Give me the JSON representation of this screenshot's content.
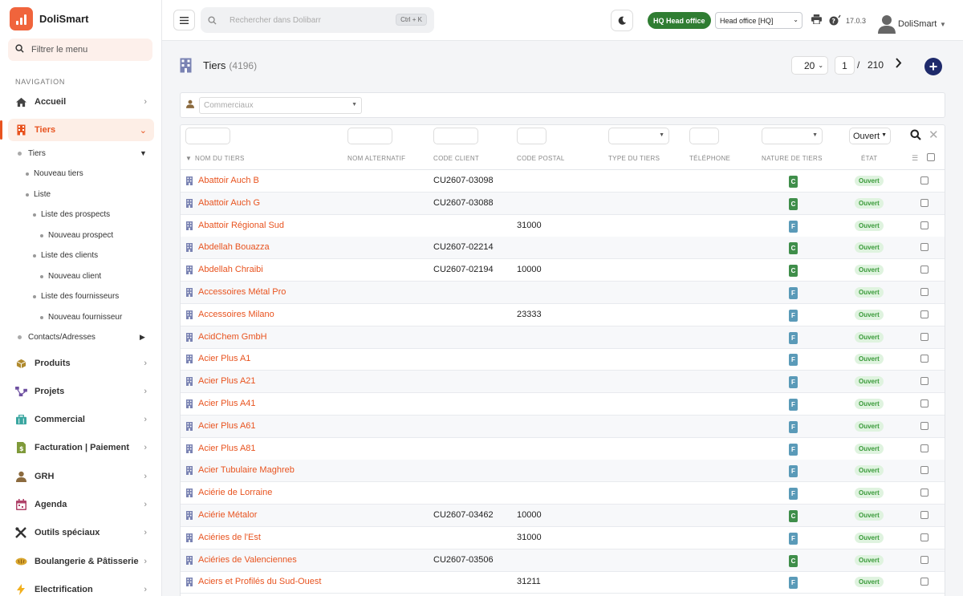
{
  "brand": {
    "name": "DoliSmart"
  },
  "sidebar": {
    "filter_placeholder": "Filtrer le menu",
    "nav_title": "NAVIGATION",
    "items": [
      {
        "label": "Accueil",
        "icon": "home-icon"
      },
      {
        "label": "Tiers",
        "icon": "building-icon"
      },
      {
        "label": "Produits",
        "icon": "box-icon"
      },
      {
        "label": "Projets",
        "icon": "projects-icon"
      },
      {
        "label": "Commercial",
        "icon": "briefcase-icon"
      },
      {
        "label": "Facturation | Paiement",
        "icon": "invoice-icon"
      },
      {
        "label": "GRH",
        "icon": "user-icon"
      },
      {
        "label": "Agenda",
        "icon": "calendar-icon"
      },
      {
        "label": "Outils spéciaux",
        "icon": "tools-icon"
      },
      {
        "label": "Boulangerie & Pâtisserie",
        "icon": "bread-icon"
      },
      {
        "label": "Electrification",
        "icon": "bolt-icon"
      }
    ],
    "sub": {
      "tiers": "Tiers",
      "nouveau_tiers": "Nouveau tiers",
      "liste": "Liste",
      "liste_prospects": "Liste des prospects",
      "nouveau_prospect": "Nouveau prospect",
      "liste_clients": "Liste des clients",
      "nouveau_client": "Nouveau client",
      "liste_fournisseurs": "Liste des fournisseurs",
      "nouveau_fournisseur": "Nouveau fournisseur",
      "contacts": "Contacts/Adresses"
    }
  },
  "topbar": {
    "search_placeholder": "Rechercher dans Dolibarr",
    "search_shortcut": "Ctrl + K",
    "hq_badge": "HQ Head office",
    "entity": "Head office [HQ]",
    "version": "17.0.3",
    "user": "DoliSmart"
  },
  "page": {
    "title": "Tiers",
    "count": "(4196)",
    "limit": "20",
    "page": "1",
    "page_sep": "/",
    "total_pages": "210"
  },
  "filters": {
    "commerciaux_placeholder": "Commerciaux",
    "etat": "Ouvert"
  },
  "columns": {
    "nom": "NOM DU TIERS",
    "alt": "NOM ALTERNATIF",
    "code": "CODE CLIENT",
    "cp": "CODE POSTAL",
    "type": "TYPE DU TIERS",
    "tel": "TÉLÉPHONE",
    "nature": "NATURE DE TIERS",
    "etat": "ÉTAT"
  },
  "rows": [
    {
      "name": "Abattoir Auch B",
      "code": "CU2607-03098",
      "cp": "",
      "nature": "C",
      "etat": "Ouvert"
    },
    {
      "name": "Abattoir Auch G",
      "code": "CU2607-03088",
      "cp": "",
      "nature": "C",
      "etat": "Ouvert"
    },
    {
      "name": "Abattoir Régional Sud",
      "code": "",
      "cp": "31000",
      "nature": "F",
      "etat": "Ouvert"
    },
    {
      "name": "Abdellah Bouazza",
      "code": "CU2607-02214",
      "cp": "",
      "nature": "C",
      "etat": "Ouvert"
    },
    {
      "name": "Abdellah Chraibi",
      "code": "CU2607-02194",
      "cp": "10000",
      "nature": "C",
      "etat": "Ouvert"
    },
    {
      "name": "Accessoires Métal Pro",
      "code": "",
      "cp": "",
      "nature": "F",
      "etat": "Ouvert"
    },
    {
      "name": "Accessoires Milano",
      "code": "",
      "cp": "23333",
      "nature": "F",
      "etat": "Ouvert"
    },
    {
      "name": "AcidChem GmbH",
      "code": "",
      "cp": "",
      "nature": "F",
      "etat": "Ouvert"
    },
    {
      "name": "Acier Plus A1",
      "code": "",
      "cp": "",
      "nature": "F",
      "etat": "Ouvert"
    },
    {
      "name": "Acier Plus A21",
      "code": "",
      "cp": "",
      "nature": "F",
      "etat": "Ouvert"
    },
    {
      "name": "Acier Plus A41",
      "code": "",
      "cp": "",
      "nature": "F",
      "etat": "Ouvert"
    },
    {
      "name": "Acier Plus A61",
      "code": "",
      "cp": "",
      "nature": "F",
      "etat": "Ouvert"
    },
    {
      "name": "Acier Plus A81",
      "code": "",
      "cp": "",
      "nature": "F",
      "etat": "Ouvert"
    },
    {
      "name": "Acier Tubulaire Maghreb",
      "code": "",
      "cp": "",
      "nature": "F",
      "etat": "Ouvert"
    },
    {
      "name": "Aciérie de Lorraine",
      "code": "",
      "cp": "",
      "nature": "F",
      "etat": "Ouvert"
    },
    {
      "name": "Aciérie Métalor",
      "code": "CU2607-03462",
      "cp": "10000",
      "nature": "C",
      "etat": "Ouvert"
    },
    {
      "name": "Aciéries de l'Est",
      "code": "",
      "cp": "31000",
      "nature": "F",
      "etat": "Ouvert"
    },
    {
      "name": "Aciéries de Valenciennes",
      "code": "CU2607-03506",
      "cp": "",
      "nature": "C",
      "etat": "Ouvert"
    },
    {
      "name": "Aciers et Profilés du Sud-Ouest",
      "code": "",
      "cp": "31211",
      "nature": "F",
      "etat": "Ouvert"
    }
  ],
  "colors": {
    "accent": "#e8531f",
    "brand": "#f0643c",
    "client": "#3f8e4a",
    "supplier": "#5a9ab8",
    "hq": "#2f7d32"
  }
}
